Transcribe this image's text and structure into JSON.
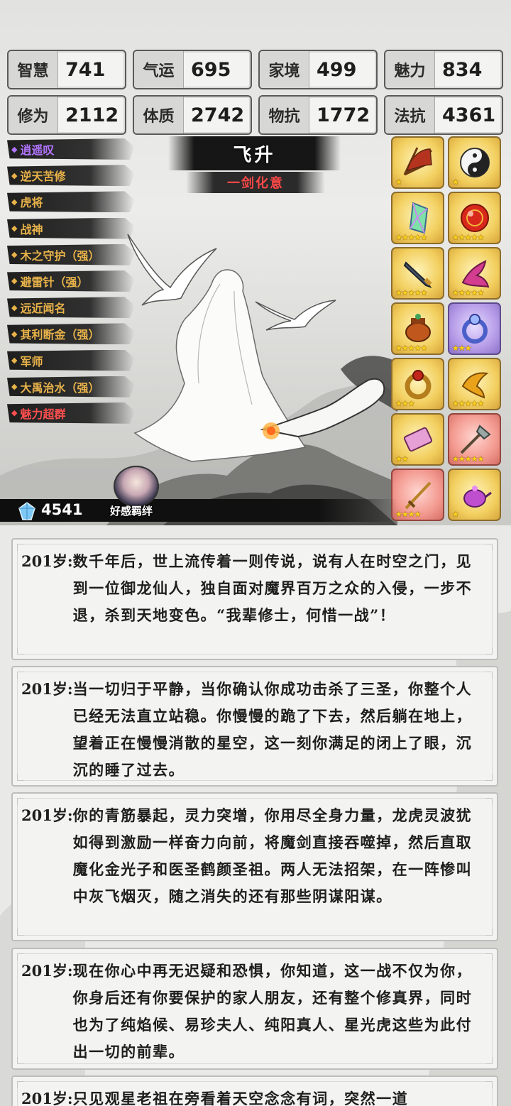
{
  "stats": [
    {
      "label": "智慧",
      "value": "741"
    },
    {
      "label": "气运",
      "value": "695"
    },
    {
      "label": "家境",
      "value": "499"
    },
    {
      "label": "魅力",
      "value": "834"
    },
    {
      "label": "修为",
      "value": "2112"
    },
    {
      "label": "体质",
      "value": "2742"
    },
    {
      "label": "物抗",
      "value": "1772"
    },
    {
      "label": "法抗",
      "value": "4361"
    }
  ],
  "talents": [
    {
      "label": "逍遥叹",
      "color": "#b274ff"
    },
    {
      "label": "逆天苦修",
      "color": "#e9b34a"
    },
    {
      "label": "虎将",
      "color": "#e9b34a"
    },
    {
      "label": "战神",
      "color": "#e9b34a"
    },
    {
      "label": "木之守护（强）",
      "color": "#e9b34a"
    },
    {
      "label": "避雷针（强）",
      "color": "#e9b34a"
    },
    {
      "label": "远近闻名",
      "color": "#e9b34a"
    },
    {
      "label": "其利断金（强）",
      "color": "#e9b34a"
    },
    {
      "label": "军师",
      "color": "#e9b34a"
    },
    {
      "label": "大禹治水（强）",
      "color": "#e9b34a"
    },
    {
      "label": "魅力超群",
      "color": "#ff4f4f"
    }
  ],
  "realm": {
    "title": "飞升",
    "subtitle": "一剑化意"
  },
  "items": [
    {
      "icon": "fan-icon",
      "rarity": "gold",
      "stars": 1
    },
    {
      "icon": "yin-yang-orb-icon",
      "rarity": "gold",
      "stars": 1
    },
    {
      "icon": "crystal-icon",
      "rarity": "gold",
      "stars": 5
    },
    {
      "icon": "red-pearl-icon",
      "rarity": "gold",
      "stars": 5
    },
    {
      "icon": "dagger-icon",
      "rarity": "gold",
      "stars": 5
    },
    {
      "icon": "phoenix-icon",
      "rarity": "gold",
      "stars": 5
    },
    {
      "icon": "cauldron-icon",
      "rarity": "gold",
      "stars": 5
    },
    {
      "icon": "ring-icon",
      "rarity": "purple",
      "stars": 3
    },
    {
      "icon": "gold-ring-icon",
      "rarity": "gold",
      "stars": 3
    },
    {
      "icon": "golden-bird-icon",
      "rarity": "gold",
      "stars": 5
    },
    {
      "icon": "scroll-icon",
      "rarity": "gold",
      "stars": 2
    },
    {
      "icon": "halberd-icon",
      "rarity": "red",
      "stars": 5
    },
    {
      "icon": "sword-icon",
      "rarity": "red",
      "stars": 4
    },
    {
      "icon": "teapot-icon",
      "rarity": "gold",
      "stars": 1
    }
  ],
  "currency": {
    "icon": "crystal-gem-icon",
    "amount": "4541"
  },
  "affinity_label": "好感羁绊",
  "logs": [
    {
      "age": "201岁:",
      "text": "数千年后，世上流传着一则传说，说有人在时空之门，见到一位御龙仙人，独自面对魔界百万之众的入侵，一步不退，杀到天地变色。“我辈修士，何惜一战”！"
    },
    {
      "age": "201岁:",
      "text": "当一切归于平静，当你确认你成功击杀了三圣，你整个人已经无法直立站稳。你慢慢的跪了下去，然后躺在地上，望着正在慢慢消散的星空，这一刻你满足的闭上了眼，沉沉的睡了过去。"
    },
    {
      "age": "201岁:",
      "text": "你的青筋暴起，灵力突增，你用尽全身力量，龙虎灵波犹如得到激励一样奋力向前，将魔剑直接吞噬掉，然后直取魔化金光子和医圣鹤颜圣祖。两人无法招架，在一阵惨叫中灰飞烟灭，随之消失的还有那些阴谋阳谋。"
    },
    {
      "age": "201岁:",
      "text": "现在你心中再无迟疑和恐惧，你知道，这一战不仅为你，你身后还有你要保护的家人朋友，还有整个修真界，同时也为了纯焰候、易珍夫人、纯阳真人、星光虎这些为此付出一切的前辈。"
    },
    {
      "age": "201岁:",
      "text": "只见观星老祖在旁看着天空念念有词，突然一道"
    }
  ]
}
